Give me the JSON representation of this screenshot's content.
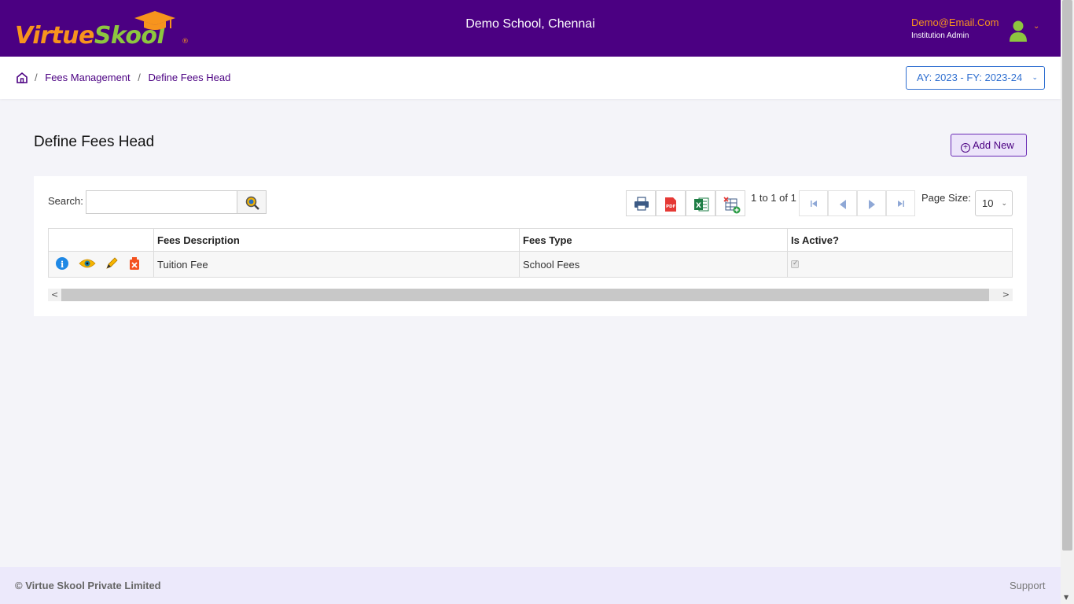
{
  "header": {
    "logo_part1": "Virtue",
    "logo_part2": "Skool",
    "logo_reg": "®",
    "school_name": "Demo School, Chennai",
    "user_email": "Demo@Email.Com",
    "user_role": "Institution Admin",
    "brand_color": "#4b0082",
    "accent_color": "#f7941d"
  },
  "breadcrumb": {
    "home_icon": "home-icon",
    "items": [
      "Fees Management",
      "Define Fees Head"
    ],
    "separator": "/"
  },
  "academic_year": "AY: 2023 - FY: 2023-24",
  "page": {
    "title": "Define Fees Head",
    "add_label": "Add New"
  },
  "toolbar": {
    "search_label": "Search:",
    "search_value": "",
    "buttons": [
      "print-icon",
      "pdf-icon",
      "excel-icon",
      "column-chooser-icon"
    ],
    "pager_text": "1 to 1 of 1",
    "page_size_label": "Page Size:",
    "page_size": "10"
  },
  "table": {
    "columns": [
      "",
      "Fees Description",
      "Fees Type",
      "Is Active?"
    ],
    "rows": [
      {
        "description": "Tuition Fee",
        "type": "School Fees",
        "active": true
      }
    ]
  },
  "footer": {
    "copyright": "© Virtue Skool Private Limited",
    "support": "Support"
  }
}
